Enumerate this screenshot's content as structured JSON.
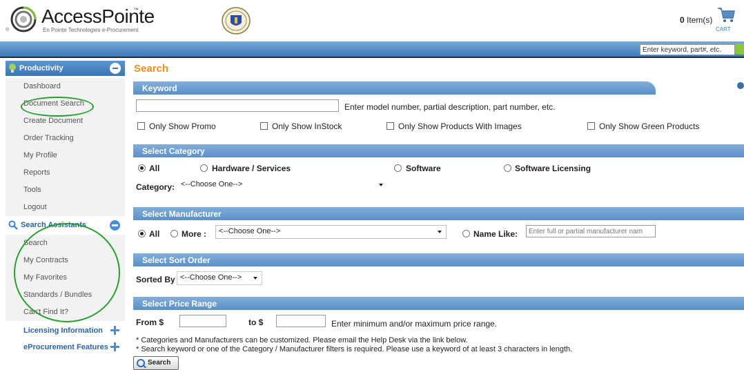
{
  "header": {
    "logo_title": "AccessPointe",
    "logo_tm": "™",
    "logo_subtitle": "En Pointe Technologies e-Procurement",
    "logo_reg": "®",
    "cart_count": "0",
    "cart_items_label": "Item(s)",
    "cart_label": "CART"
  },
  "topbar": {
    "search_placeholder": "Enter keyword, part#, etc."
  },
  "sidebar": {
    "productivity": {
      "label": "Productivity",
      "items": [
        "Dashboard",
        "Document Search",
        "Create Document",
        "Order Tracking",
        "My Profile",
        "Reports",
        "Tools",
        "Logout"
      ]
    },
    "search_assistants": {
      "label": "Search Assistants",
      "items": [
        "Search",
        "My Contracts",
        "My Favorites",
        "Standards / Bundles",
        "Can't Find It?"
      ]
    },
    "licensing": "Licensing Information",
    "eprocurement": "eProcurement Features"
  },
  "main": {
    "title": "Search",
    "keyword": {
      "section": "Keyword",
      "hint": "Enter model number, partial description, part number, etc.",
      "checkboxes": [
        "Only Show Promo",
        "Only Show InStock",
        "Only Show Products With Images",
        "Only Show Green Products"
      ]
    },
    "category": {
      "section": "Select Category",
      "radios": [
        "All",
        "Hardware / Services",
        "Software",
        "Software Licensing"
      ],
      "selected": "All",
      "label": "Category:",
      "select_value": "<--Choose One-->"
    },
    "manufacturer": {
      "section": "Select Manufacturer",
      "all": "All",
      "more": "More :",
      "select_value": "<--Choose One-->",
      "name_like": "Name Like:",
      "name_placeholder": "Enter full or partial manufacturer nam"
    },
    "sort": {
      "section": "Select Sort Order",
      "label": "Sorted By",
      "select_value": "<--Choose One-->"
    },
    "price": {
      "section": "Select Price Range",
      "from": "From $",
      "to": "to $",
      "hint": "Enter minimum and/or maximum price range."
    },
    "notes": [
      "* Categories and Manufacturers can be customized. Please email the Help Desk via the link below.",
      "* Search keyword or one of the Category / Manufacturer filters is required. Please use a keyword of at least 3 characters in length."
    ],
    "search_button": "Search"
  },
  "colors": {
    "accent_orange": "#f28c1a",
    "section_blue": "#5b90c8",
    "annotation_green": "#27a02e"
  }
}
